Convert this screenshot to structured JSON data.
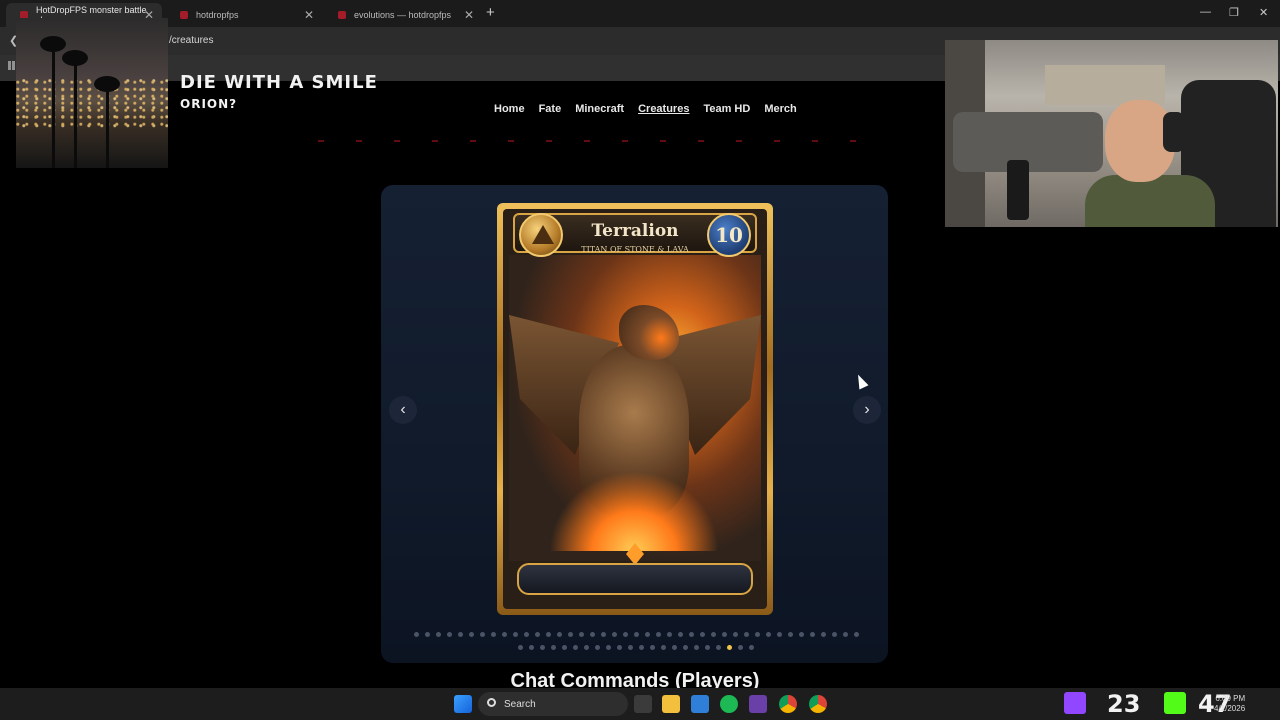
{
  "browser": {
    "tabs": [
      {
        "label": "HotDropFPS monster battle sh",
        "active": true
      },
      {
        "label": "hotdropfps",
        "active": false
      },
      {
        "label": "evolutions — hotdropfps",
        "active": false
      }
    ],
    "url": "/creatures",
    "window_controls": [
      "—",
      "❐",
      "✕"
    ]
  },
  "site": {
    "title": "DIE WITH A SMILE",
    "subtitle": "ORION?",
    "nav": [
      {
        "label": "Home",
        "active": false
      },
      {
        "label": "Fate",
        "active": false
      },
      {
        "label": "Minecraft",
        "active": false
      },
      {
        "label": "Creatures",
        "active": true
      },
      {
        "label": "Team HD",
        "active": false
      },
      {
        "label": "Merch",
        "active": false
      }
    ]
  },
  "carousel": {
    "prev_label": "‹",
    "next_label": "›",
    "card": {
      "name": "Terralion",
      "subtitle": "TITAN OF STONE & LAVA",
      "level": "10",
      "element_icon": "earth-triangle-icon"
    },
    "dots_row1": 41,
    "dots_row2": 22,
    "active_row": 2,
    "active_index": 19
  },
  "section": {
    "title": "Chat Commands (Players)"
  },
  "taskbar": {
    "search_label": "Search",
    "tray_count_1": "23",
    "tray_count_2": "47",
    "time": "6:09 PM",
    "date": "4/1/2026"
  },
  "colors": {
    "accent_gold": "#f0c34a",
    "nav_red": "#a1141d",
    "carousel_bg": "#152033"
  }
}
